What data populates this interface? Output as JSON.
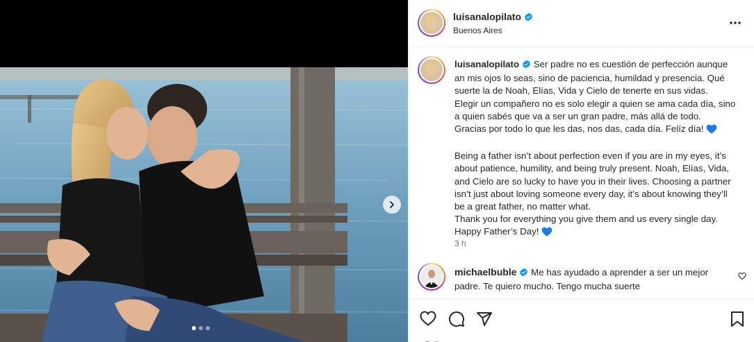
{
  "post": {
    "username": "luisanalopilato",
    "location": "Buenos Aires",
    "caption_es": [
      "Ser padre no es cuestión de perfección aunque an mis ojos lo seas, sino de paciencia, humildad y presencia. Qué suerte la de Noah, Elías, Vida y Cielo de tenerte en sus vidas.",
      "Elegir un compañero no es solo elegir a quien se ama cada día, sino a quien sabés que va a ser un gran padre, más allá de todo.",
      "Gracias por todo lo que les das, nos das, cada día. Felíz día!"
    ],
    "caption_en": [
      "Being a father isn’t about perfection even if you are in my eyes, it’s about patience, humility, and being truly present. Noah, Elías, Vida, and Cielo are so lucky to have you in their lives. Choosing a partner isn’t just about loving someone every day, it’s about knowing they’ll be a great father, no matter what.",
      "Thank you for everything you give them and us every single day.",
      "Happy Father’s Day!"
    ],
    "time": "3 h",
    "carousel": {
      "count": 3,
      "active": 0
    }
  },
  "comment": {
    "username": "michaelbuble",
    "text": "Me has ayudado a aprender a ser un mejor padre. Te quiero mucho. Tengo mucha suerte"
  },
  "icons": {
    "verified": "verified-badge-icon",
    "more": "more-options-icon",
    "like": "heart-outline-icon",
    "comment": "comment-bubble-icon",
    "share": "paper-plane-icon",
    "save": "bookmark-icon",
    "next": "chevron-right-icon"
  },
  "colors": {
    "verified": "#0095f6",
    "heart_emoji": "#1d7ae6",
    "muted": "#737373",
    "text": "#262626"
  }
}
